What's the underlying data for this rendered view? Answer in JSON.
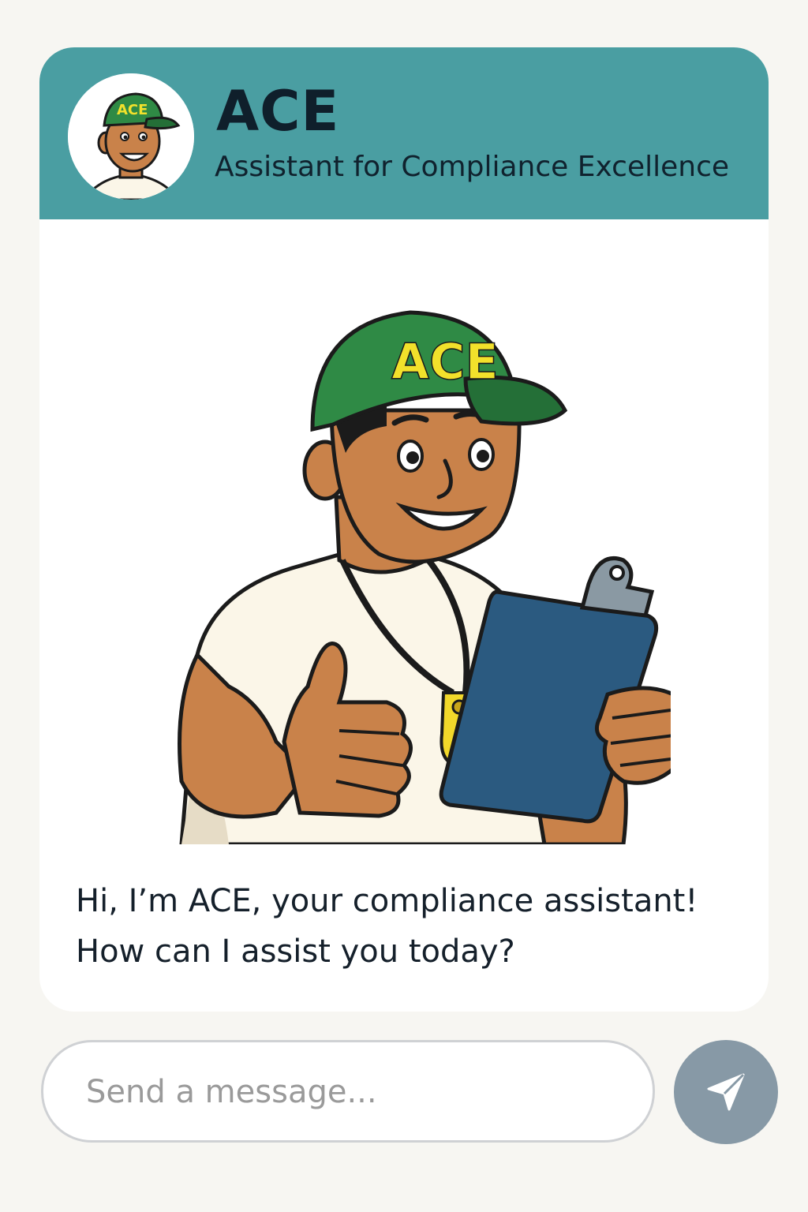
{
  "header": {
    "title": "ACE",
    "subtitle": "Assistant for Compliance Excellence",
    "avatar_icon": "ace-mascot-avatar"
  },
  "mascot": {
    "cap_text": "ACE",
    "icon": "ace-mascot-illustration"
  },
  "message": {
    "line1": "Hi, I’m ACE, your compliance assistant!",
    "line2": "How can I assist you today?"
  },
  "composer": {
    "placeholder": "Send a message...",
    "value": "",
    "send_icon": "send-icon"
  },
  "colors": {
    "header_bg": "#4a9ea2",
    "page_bg": "#f7f6f2",
    "send_button": "#8799a6",
    "cap_green": "#2f8a45",
    "cap_text": "#f2e12b",
    "clipboard": "#2b5a80"
  }
}
